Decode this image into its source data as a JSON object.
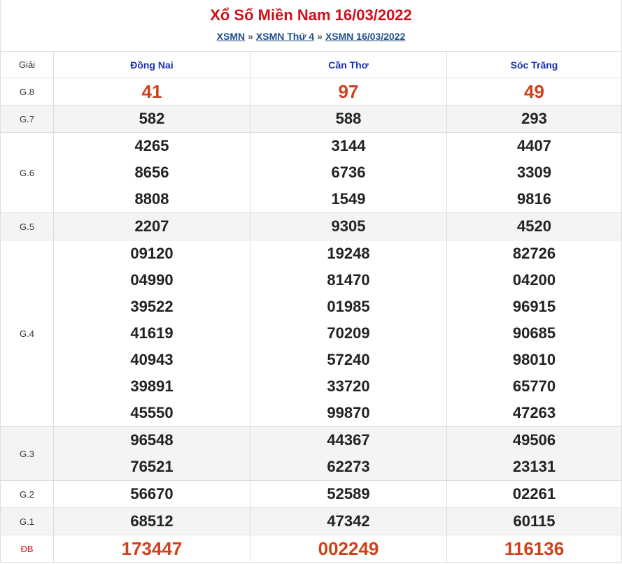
{
  "header": {
    "title": "Xổ Số Miền Nam 16/03/2022",
    "breadcrumb": [
      "XSMN",
      "XSMN Thứ 4",
      "XSMN 16/03/2022"
    ],
    "separator": "»"
  },
  "table": {
    "prize_header": "Giải",
    "provinces": [
      "Đồng Nai",
      "Cần Thơ",
      "Sóc Trăng"
    ],
    "rows": [
      {
        "prize": "G.8",
        "values": [
          [
            "41"
          ],
          [
            "97"
          ],
          [
            "49"
          ]
        ]
      },
      {
        "prize": "G.7",
        "values": [
          [
            "582"
          ],
          [
            "588"
          ],
          [
            "293"
          ]
        ]
      },
      {
        "prize": "G.6",
        "values": [
          [
            "4265",
            "8656",
            "8808"
          ],
          [
            "3144",
            "6736",
            "1549"
          ],
          [
            "4407",
            "3309",
            "9816"
          ]
        ]
      },
      {
        "prize": "G.5",
        "values": [
          [
            "2207"
          ],
          [
            "9305"
          ],
          [
            "4520"
          ]
        ]
      },
      {
        "prize": "G.4",
        "values": [
          [
            "09120",
            "04990",
            "39522",
            "41619",
            "40943",
            "39891",
            "45550"
          ],
          [
            "19248",
            "81470",
            "01985",
            "70209",
            "57240",
            "33720",
            "99870"
          ],
          [
            "82726",
            "04200",
            "96915",
            "90685",
            "98010",
            "65770",
            "47263"
          ]
        ]
      },
      {
        "prize": "G.3",
        "values": [
          [
            "96548",
            "76521"
          ],
          [
            "44367",
            "62273"
          ],
          [
            "49506",
            "23131"
          ]
        ]
      },
      {
        "prize": "G.2",
        "values": [
          [
            "56670"
          ],
          [
            "52589"
          ],
          [
            "02261"
          ]
        ]
      },
      {
        "prize": "G.1",
        "values": [
          [
            "68512"
          ],
          [
            "47342"
          ],
          [
            "60115"
          ]
        ]
      },
      {
        "prize": "ĐB",
        "values": [
          [
            "173447"
          ],
          [
            "002249"
          ],
          [
            "116136"
          ]
        ]
      }
    ]
  },
  "colors": {
    "title": "#d0111b",
    "link": "#1f4f8b",
    "province": "#1b2fb5",
    "highlight_number": "#d0401b",
    "alt_row": "#f4f4f4"
  }
}
